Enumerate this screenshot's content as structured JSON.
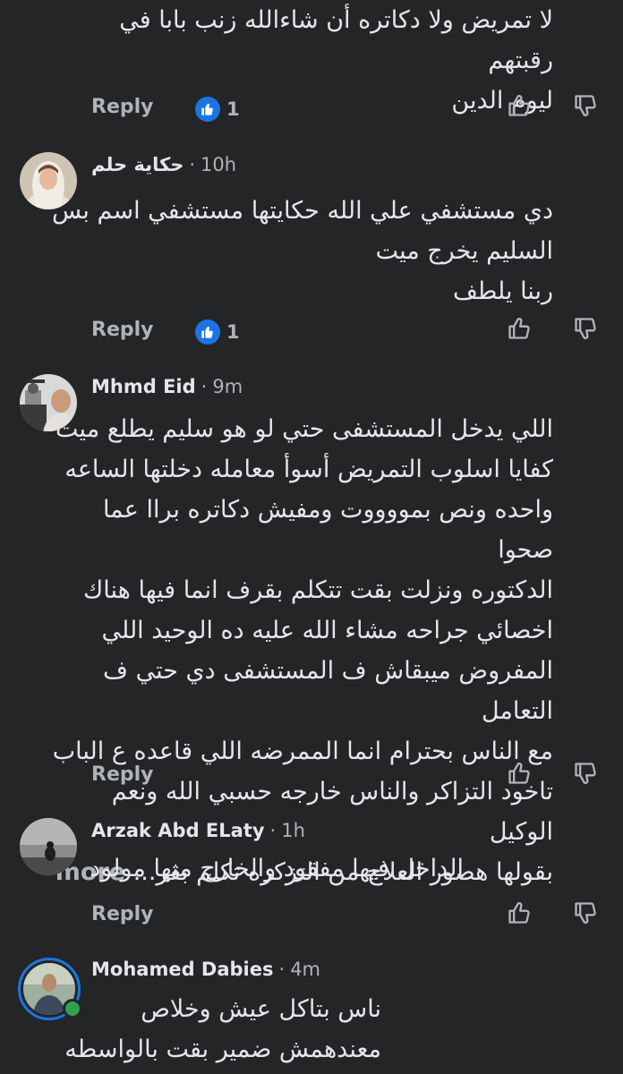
{
  "comments": [
    {
      "lines": [
        "لا تمريض ولا دكاتره أن شاءالله زنب بابا في رقبتهم",
        "ليوم الدين"
      ],
      "reply_label": "Reply",
      "like_count": "1"
    },
    {
      "author": "حكاية حلم",
      "separator": "·",
      "time": "10h",
      "lines": [
        "دي مستشفي علي الله حكايتها مستشفي اسم بس",
        "السليم يخرج ميت",
        "ربنا يلطف"
      ],
      "reply_label": "Reply",
      "like_count": "1"
    },
    {
      "author": "Mhmd Eid",
      "separator": "·",
      "time": "9m",
      "lines": [
        "اللي يدخل المستشفى حتي لو هو سليم يطلع ميت",
        "كفايا اسلوب التمريض أسوأ معامله دخلتها الساعه",
        "واحده ونص بمووووت ومفيش دكاتره براا عما صحوا",
        "الدكتوره ونزلت بقت تتكلم بقرف انما فيها هناك",
        "اخصائي جراحه مشاء الله عليه ده الوحيد اللي",
        "المفروض ميبقاش ف المستشفى دي حتي ف التعامل",
        "مع الناس بحترام انما الممرضه اللي قاعده ع الباب",
        "تاخود التزاكر والناس خارجه حسبي الله ونعم الوكيل"
      ],
      "last_line": "بقولها هصور العلاج من التزكره تكلم بقر...",
      "more_label": "more",
      "reply_label": "Reply"
    },
    {
      "author": "Arzak Abd ELaty",
      "separator": "·",
      "time": "1h",
      "lines": [
        "الداخل فيها مفقود والخارج منها مولود"
      ],
      "reply_label": "Reply"
    },
    {
      "author": "Mohamed Dabies",
      "separator": "·",
      "time": "4m",
      "lines": [
        "ناس بتاكل عيش وخلاص",
        "معندهمش ضمير بقت بالواسطه"
      ]
    }
  ],
  "colors": {
    "background": "#242526",
    "text": "#e4e6eb",
    "muted": "#b0b3b8",
    "like_blue": "#1b74e4",
    "online_green": "#31a24c"
  },
  "icons": [
    "like-badge-icon",
    "thumbs-up-icon",
    "thumbs-down-icon",
    "online-dot-icon"
  ]
}
